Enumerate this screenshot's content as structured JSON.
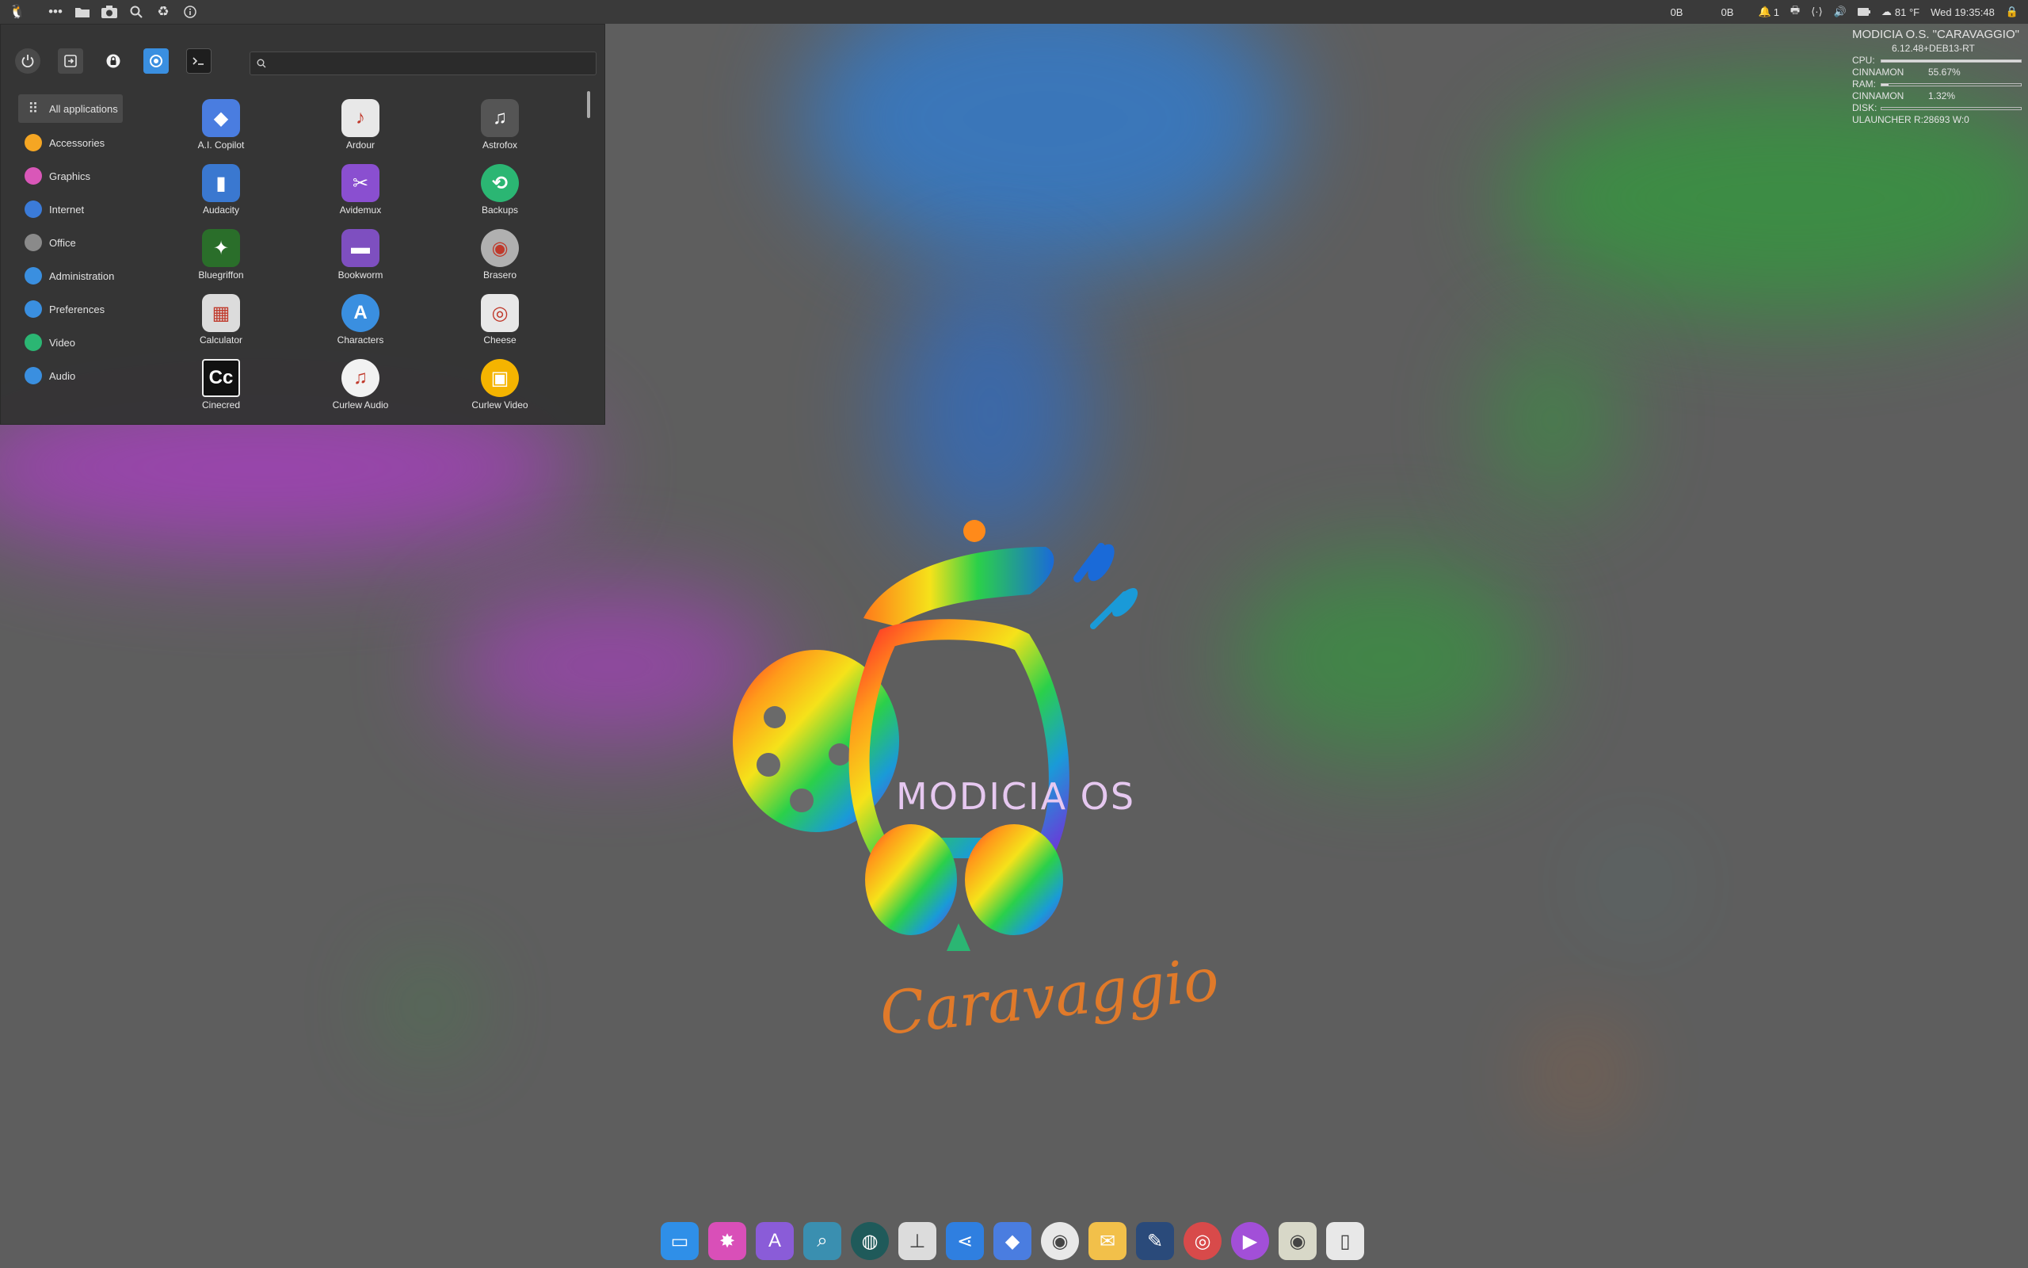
{
  "top_panel": {
    "net_down": "0B",
    "net_up": "0B",
    "notifications": "1",
    "temperature": "81 °F",
    "clock": "Wed 19:35:48"
  },
  "conky": {
    "title": "MODICIA O.S. \"CARAVAGGIO\"",
    "kernel": "6.12.48+DEB13-RT",
    "cpu_label": "CPU:",
    "cpu_level": 1.0,
    "cpu_proc_name": "CINNAMON",
    "cpu_proc_value": "55.67%",
    "ram_label": "RAM:",
    "ram_level": 0.05,
    "ram_proc_name": "CINNAMON",
    "ram_proc_value": "1.32%",
    "disk_label": "DISK:",
    "disk_level": 0.0,
    "launcher": "ULAUNCHER R:28693 W:0"
  },
  "menu": {
    "search_placeholder": "",
    "categories": [
      {
        "label": "All applications",
        "icon": "grid-icon",
        "color": "#4a4a4a"
      },
      {
        "label": "Accessories",
        "icon": "accessories-icon",
        "color": "#f5a623"
      },
      {
        "label": "Graphics",
        "icon": "graphics-icon",
        "color": "#d957b8"
      },
      {
        "label": "Internet",
        "icon": "globe-icon",
        "color": "#3b7bd8"
      },
      {
        "label": "Office",
        "icon": "office-icon",
        "color": "#8a8a8a"
      },
      {
        "label": "Administration",
        "icon": "administration-icon",
        "color": "#3a8fe0"
      },
      {
        "label": "Preferences",
        "icon": "preferences-icon",
        "color": "#3a8fe0"
      },
      {
        "label": "Video",
        "icon": "video-icon",
        "color": "#2bb673"
      },
      {
        "label": "Audio",
        "icon": "audio-icon",
        "color": "#3a8fe0"
      }
    ],
    "apps": [
      {
        "label": "A.I. Copilot",
        "icon": "copilot-icon",
        "color": "#4a7de0"
      },
      {
        "label": "Ardour",
        "icon": "ardour-icon",
        "color": "#e8e8e8"
      },
      {
        "label": "Astrofox",
        "icon": "astrofox-icon",
        "color": "#555"
      },
      {
        "label": "Audacity",
        "icon": "audacity-icon",
        "color": "#3a78d0"
      },
      {
        "label": "Avidemux",
        "icon": "avidemux-icon",
        "color": "#8a4fd0"
      },
      {
        "label": "Backups",
        "icon": "backups-icon",
        "color": "#2bb673"
      },
      {
        "label": "Bluegriffon",
        "icon": "bluegriffon-icon",
        "color": "#2a6e2a"
      },
      {
        "label": "Bookworm",
        "icon": "bookworm-icon",
        "color": "#7e4fc0"
      },
      {
        "label": "Brasero",
        "icon": "brasero-icon",
        "color": "#b0b0b0"
      },
      {
        "label": "Calculator",
        "icon": "calculator-icon",
        "color": "#dcdcdc"
      },
      {
        "label": "Characters",
        "icon": "characters-icon",
        "color": "#3a8fe0"
      },
      {
        "label": "Cheese",
        "icon": "cheese-icon",
        "color": "#e8e8e8"
      },
      {
        "label": "Cinecred",
        "icon": "cinecred-icon",
        "color": "#111111"
      },
      {
        "label": "Curlew Audio",
        "icon": "curlew-audio-icon",
        "color": "#f2f2f2"
      },
      {
        "label": "Curlew Video",
        "icon": "curlew-video-icon",
        "color": "#f5b400"
      }
    ]
  },
  "dock": [
    {
      "icon": "files-icon",
      "color": "#2f8fe8"
    },
    {
      "icon": "color-picker-icon",
      "color": "#d94fb8"
    },
    {
      "icon": "software-store-icon",
      "color": "#8a5cd8"
    },
    {
      "icon": "image-viewer-icon",
      "color": "#3a8fb0"
    },
    {
      "icon": "terminal-icon",
      "color": "#1f5a5a"
    },
    {
      "icon": "settings-tweaks-icon",
      "color": "#dcdcdc"
    },
    {
      "icon": "share-icon",
      "color": "#2f7fe0"
    },
    {
      "icon": "copilot-icon",
      "color": "#4a7de0"
    },
    {
      "icon": "chrome-icon",
      "color": "#e8e8e8"
    },
    {
      "icon": "mail-icon",
      "color": "#f2c04a"
    },
    {
      "icon": "text-editor-icon",
      "color": "#2a4a7a"
    },
    {
      "icon": "camera-app-icon",
      "color": "#d84a4a"
    },
    {
      "icon": "media-player-icon",
      "color": "#a24fd8"
    },
    {
      "icon": "speaker-icon",
      "color": "#d8d8c8"
    },
    {
      "icon": "trash-icon",
      "color": "#e8e8e8"
    }
  ],
  "wallpaper": {
    "logo_text": "MODICIA OS",
    "signature": "Caravaggio"
  }
}
